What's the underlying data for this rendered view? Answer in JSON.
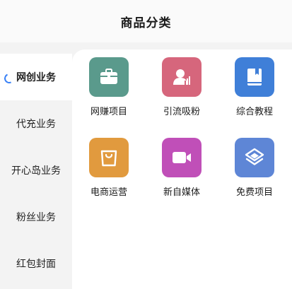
{
  "header": {
    "title": "商品分类"
  },
  "sidebar": {
    "items": [
      {
        "label": "网创业务",
        "active": true
      },
      {
        "label": "代充业务",
        "active": false
      },
      {
        "label": "开心岛业务",
        "active": false
      },
      {
        "label": "粉丝业务",
        "active": false
      },
      {
        "label": "红包封面",
        "active": false
      }
    ]
  },
  "grid": {
    "items": [
      {
        "label": "网赚项目",
        "icon": "briefcase-icon",
        "color": "#5a9a8c"
      },
      {
        "label": "引流吸粉",
        "icon": "user-chart-icon",
        "color": "#d6667c"
      },
      {
        "label": "综合教程",
        "icon": "book-icon",
        "color": "#3f7fd8"
      },
      {
        "label": "电商运营",
        "icon": "shopping-bag-icon",
        "color": "#e19a3e"
      },
      {
        "label": "新自媒体",
        "icon": "video-camera-icon",
        "color": "#c04fb8"
      },
      {
        "label": "免费项目",
        "icon": "layers-icon",
        "color": "#5e86d6"
      }
    ]
  }
}
